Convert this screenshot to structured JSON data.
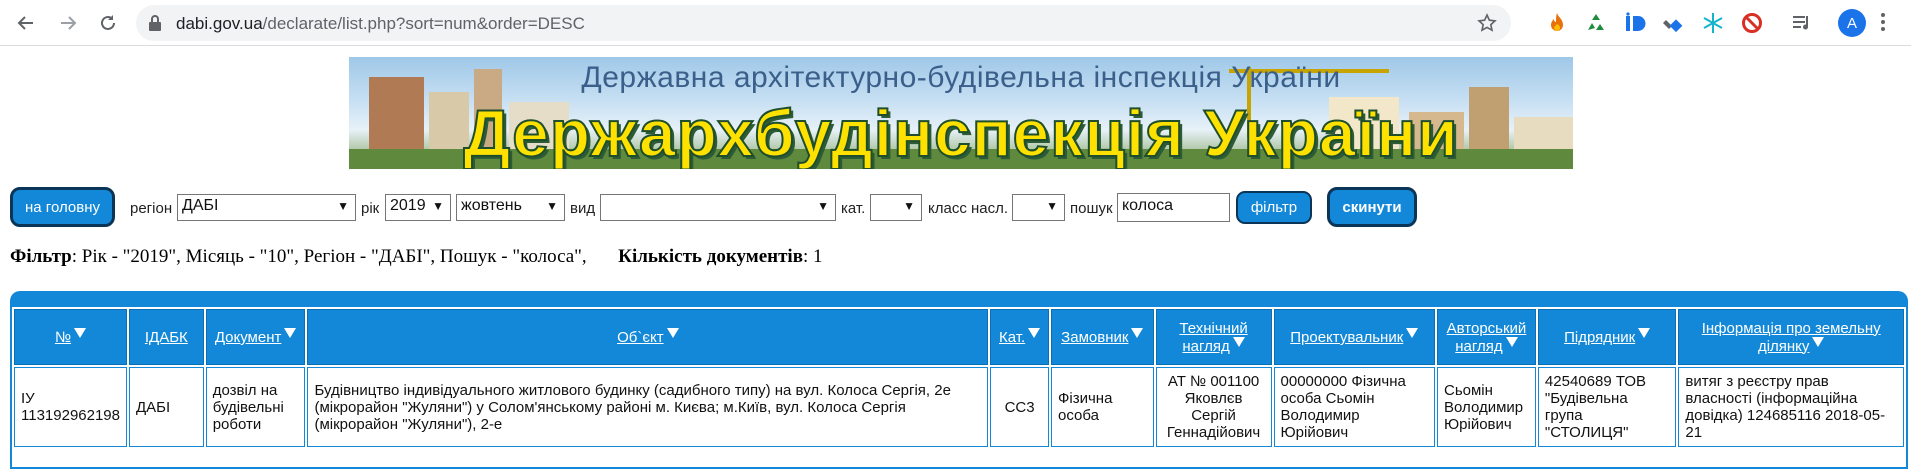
{
  "browser": {
    "url_host": "dabi.gov.ua",
    "url_path": "/declarate/list.php?sort=num&order=DESC",
    "avatar_letter": "A"
  },
  "banner": {
    "subtitle": "Державна архітектурно-будівельна інспекція України",
    "title": "Держархбудінспекція України"
  },
  "filters": {
    "home_button": "на головну",
    "region_label": "регіон",
    "region_value": "ДАБІ",
    "year_label": "рік",
    "year_value": "2019",
    "month_value": "жовтень",
    "kind_label": "вид",
    "kind_value": "",
    "cat_label": "кат.",
    "cat_value": "",
    "class_label": "класс насл.",
    "class_value": "",
    "search_label": "пошук",
    "search_value": "колоса",
    "filter_button": "фільтр",
    "reset_button": "скинути"
  },
  "summary": {
    "filter_label": "Фільтр",
    "filter_text": ": Рік - \"2019\", Місяць - \"10\", Регіон - \"ДАБІ\", Пошук - \"колоса\",",
    "count_label": "Кількість документів",
    "count_value": ": 1"
  },
  "table": {
    "headers": [
      "№",
      "ІДАБК",
      "Документ",
      "Об`єкт",
      "Кат.",
      "Замовник",
      "Технічний нагляд",
      "Проектувальник",
      "Авторський нагляд",
      "Підрядник",
      "Інформація про земельну ділянку"
    ],
    "rows": [
      {
        "num": "ІУ 113192962198",
        "idabk": "ДАБІ",
        "document": "дозвіл на будівельні роботи",
        "object": "Будівництво індивідуального житлового будинку (садибного типу) на вул. Колоса Сергія, 2е (мікрорайон \"Жуляни\") у Солом'янському районі м. Києва; м.Київ, вул. Колоса Сергія (мікрорайон \"Жуляни\"), 2-е",
        "cat": "СС3",
        "customer": "Фізична особа",
        "tech_supervision": "АТ № 001100 Яковлєв Сергій Геннадійович",
        "designer": "00000000 Фізична особа Сьомін Володимир Юрійович",
        "author_supervision": "Сьомін Володимир Юрійович",
        "contractor": "42540689 ТОВ \"Будівельна група \"СТОЛИЦЯ\"",
        "land_info": "витяг з реєстру прав власності (інформаційна довідка) 124685116 2018-05-21"
      }
    ]
  }
}
